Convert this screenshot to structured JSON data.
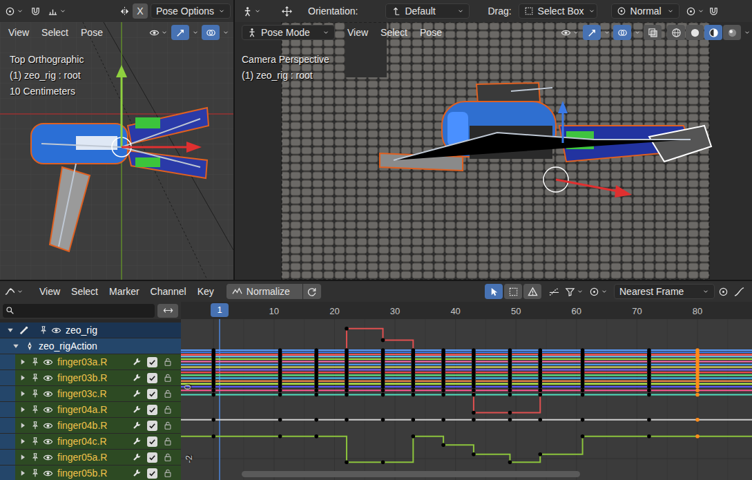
{
  "header_left": {
    "mirror_x": {
      "label": "X",
      "on": false
    },
    "pose_options": "Pose Options"
  },
  "header_right": {
    "orientation_label": "Orientation:",
    "orientation": "Default",
    "drag_label": "Drag:",
    "drag": "Select Box",
    "pivot": "Normal"
  },
  "viewports": [
    {
      "title": "Top Orthographic",
      "object": "(1) zeo_rig : root",
      "scale": "10 Centimeters",
      "menus": [
        "View",
        "Select",
        "Pose"
      ],
      "gizmos_on": true,
      "overlays_on": true
    },
    {
      "title": "Camera Perspective",
      "object": "(1) zeo_rig : root",
      "mode": "Pose Mode",
      "menus": [
        "View",
        "Select",
        "Pose"
      ],
      "gizmos_on": true,
      "overlays_on": true,
      "xray_on": false,
      "shading": [
        {
          "selected": false
        },
        {
          "selected": false
        },
        {
          "selected": true
        },
        {
          "selected": false
        }
      ]
    }
  ],
  "graph_editor": {
    "menus": [
      "View",
      "Select",
      "Marker",
      "Channel",
      "Key"
    ],
    "normalize": {
      "label": "Normalize",
      "on": false
    },
    "tools": [
      {
        "selected": true
      },
      {
        "selected": false
      },
      {
        "selected": false
      }
    ],
    "snapping": "Nearest Frame",
    "current_frame": "1",
    "frame_ticks": [
      "10",
      "20",
      "30",
      "40",
      "50",
      "60",
      "70",
      "80"
    ],
    "value_ticks": [
      {
        "label": "0",
        "value": 0
      },
      {
        "label": "-2",
        "value": -2
      }
    ],
    "channels": [
      {
        "name": "zeo_rig",
        "kind": "object",
        "expanded": true,
        "visible": true
      },
      {
        "name": "zeo_rigAction",
        "kind": "action",
        "expanded": true
      },
      {
        "name": "finger03a.R",
        "kind": "bone",
        "expanded": false,
        "visible": true,
        "checked": true
      },
      {
        "name": "finger03b.R",
        "kind": "bone",
        "expanded": false,
        "visible": true,
        "checked": true
      },
      {
        "name": "finger03c.R",
        "kind": "bone",
        "expanded": false,
        "visible": true,
        "checked": true
      },
      {
        "name": "finger04a.R",
        "kind": "bone",
        "expanded": false,
        "visible": true,
        "checked": true
      },
      {
        "name": "finger04b.R",
        "kind": "bone",
        "expanded": false,
        "visible": true,
        "checked": true
      },
      {
        "name": "finger04c.R",
        "kind": "bone",
        "expanded": false,
        "visible": true,
        "checked": true
      },
      {
        "name": "finger05a.R",
        "kind": "bone",
        "expanded": false,
        "visible": true,
        "checked": true
      },
      {
        "name": "finger05b.R",
        "kind": "bone",
        "expanded": false,
        "visible": true,
        "checked": true
      }
    ],
    "keyframes": [
      {
        "frame": 0,
        "selected": false
      },
      {
        "frame": 11,
        "selected": false
      },
      {
        "frame": 17,
        "selected": false
      },
      {
        "frame": 22,
        "selected": false
      },
      {
        "frame": 28,
        "selected": false
      },
      {
        "frame": 33,
        "selected": false
      },
      {
        "frame": 38,
        "selected": false
      },
      {
        "frame": 43,
        "selected": false
      },
      {
        "frame": 49,
        "selected": false
      },
      {
        "frame": 54,
        "selected": false
      },
      {
        "frame": 61,
        "selected": false
      },
      {
        "frame": 72,
        "selected": false
      },
      {
        "frame": 80,
        "selected": true
      }
    ],
    "series": [
      {
        "color": "#5c9cff",
        "values": [
          1.02,
          1.02,
          1.02,
          1.02,
          1.02,
          1.02,
          1.02,
          1.02,
          1.02,
          1.02,
          1.02,
          1.02,
          1.02
        ]
      },
      {
        "color": "#3a7ae8",
        "values": [
          0.96,
          0.96,
          0.96,
          0.96,
          0.96,
          0.96,
          0.96,
          0.96,
          0.96,
          0.96,
          0.96,
          0.96,
          0.96
        ]
      },
      {
        "color": "#ff5a5a",
        "values": [
          0.9,
          0.9,
          0.9,
          0.9,
          0.9,
          0.9,
          0.9,
          0.9,
          0.9,
          0.9,
          0.9,
          0.9,
          0.9
        ]
      },
      {
        "color": "#58d4ff",
        "values": [
          0.84,
          0.84,
          0.84,
          0.84,
          0.84,
          0.84,
          0.84,
          0.84,
          0.84,
          0.84,
          0.84,
          0.84,
          0.84
        ]
      },
      {
        "color": "#9fe03c",
        "values": [
          0.77,
          0.77,
          0.77,
          0.77,
          0.77,
          0.77,
          0.77,
          0.77,
          0.77,
          0.77,
          0.77,
          0.77,
          0.77
        ]
      },
      {
        "color": "#ff6aa8",
        "values": [
          0.7,
          0.7,
          0.7,
          0.7,
          0.7,
          0.7,
          0.7,
          0.7,
          0.7,
          0.7,
          0.7,
          0.7,
          0.7
        ]
      },
      {
        "color": "#4aa2ff",
        "values": [
          0.62,
          0.62,
          0.62,
          0.62,
          0.62,
          0.62,
          0.62,
          0.62,
          0.62,
          0.62,
          0.62,
          0.62,
          0.62
        ]
      },
      {
        "color": "#e6e05a",
        "values": [
          0.55,
          0.55,
          0.55,
          0.55,
          0.55,
          0.55,
          0.55,
          0.55,
          0.55,
          0.55,
          0.55,
          0.55,
          0.55
        ]
      },
      {
        "color": "#7a66ff",
        "values": [
          0.47,
          0.47,
          0.47,
          0.47,
          0.47,
          0.47,
          0.47,
          0.47,
          0.47,
          0.47,
          0.47,
          0.47,
          0.47
        ]
      },
      {
        "color": "#ff4a4a",
        "values": [
          0.4,
          0.4,
          0.4,
          0.4,
          0.4,
          0.4,
          0.4,
          0.4,
          0.4,
          0.4,
          0.4,
          0.4,
          0.4
        ]
      },
      {
        "color": "#62f084",
        "values": [
          0.32,
          0.32,
          0.32,
          0.32,
          0.32,
          0.32,
          0.32,
          0.32,
          0.32,
          0.32,
          0.32,
          0.32,
          0.32
        ]
      },
      {
        "color": "#46c2ff",
        "values": [
          0.24,
          0.24,
          0.24,
          0.24,
          0.24,
          0.24,
          0.24,
          0.24,
          0.24,
          0.24,
          0.24,
          0.24,
          0.24
        ]
      },
      {
        "color": "#ff8a46",
        "values": [
          0.16,
          0.16,
          0.16,
          0.16,
          0.16,
          0.16,
          0.16,
          0.16,
          0.16,
          0.16,
          0.16,
          0.16,
          0.16
        ]
      },
      {
        "color": "#c2ff46",
        "values": [
          0.08,
          0.08,
          0.08,
          0.08,
          0.08,
          0.08,
          0.08,
          0.08,
          0.08,
          0.08,
          0.08,
          0.08,
          0.08
        ]
      },
      {
        "color": "#5858ff",
        "values": [
          0.0,
          0.0,
          0.0,
          0.0,
          0.0,
          0.0,
          0.0,
          0.0,
          0.0,
          0.0,
          0.0,
          0.0,
          0.0
        ]
      },
      {
        "color": "#ff5890",
        "values": [
          -0.1,
          -0.1,
          -0.1,
          -0.1,
          -0.1,
          -0.1,
          -0.1,
          -0.1,
          -0.1,
          -0.1,
          -0.1,
          -0.1,
          -0.1
        ]
      },
      {
        "color": "#50e0c0",
        "values": [
          -0.22,
          -0.22,
          -0.22,
          -0.22,
          -0.22,
          -0.22,
          -0.22,
          -0.22,
          -0.22,
          -0.22,
          -0.22,
          -0.22,
          -0.22
        ]
      },
      {
        "color": "#d0d0d0",
        "values": [
          -0.92,
          -0.92,
          -0.92,
          -0.92,
          -0.92,
          -0.92,
          -0.92,
          -0.92,
          -0.92,
          -0.92,
          -0.92,
          -0.92,
          -0.92
        ]
      },
      {
        "color": "#e05050",
        "values": [
          0.88,
          0.88,
          0.88,
          1.62,
          1.3,
          0.88,
          0.88,
          -0.72,
          -0.72,
          0.88,
          0.88,
          0.88,
          0.88
        ]
      },
      {
        "color": "#8cc43c",
        "values": [
          -1.38,
          -1.38,
          -1.38,
          -2.1,
          -2.1,
          -1.38,
          -1.62,
          -1.88,
          -2.1,
          -1.88,
          -1.38,
          -1.38,
          -1.38
        ]
      }
    ]
  }
}
